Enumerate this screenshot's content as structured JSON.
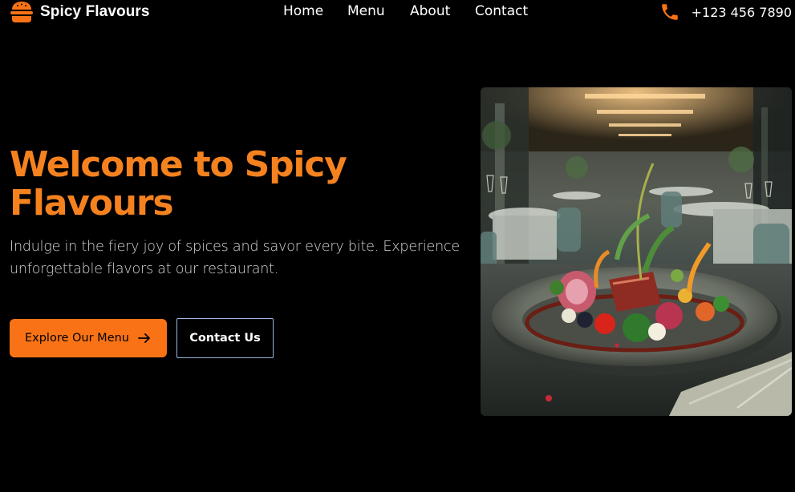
{
  "header": {
    "brand": {
      "name": "Spicy Flavours",
      "icon": "burger-icon",
      "icon_color": "#f97316"
    },
    "nav": [
      {
        "label": "Home"
      },
      {
        "label": "Menu"
      },
      {
        "label": "About"
      },
      {
        "label": "Contact"
      }
    ],
    "phone": {
      "number": "+123 456 7890",
      "icon": "phone-icon",
      "icon_color": "#f97316"
    }
  },
  "hero": {
    "title": "Welcome to Spicy Flavours",
    "subtitle": "Indulge in the fiery joy of spices and savor every bite. Experience unforgettable flavors at our restaurant.",
    "primary_button": {
      "label": "Explore Our Menu",
      "icon": "arrow-right-icon"
    },
    "secondary_button": {
      "label": "Contact Us"
    },
    "image": {
      "subject": "gourmet-dish-restaurant-photo"
    }
  },
  "colors": {
    "accent": "#f97316",
    "title": "#f5821f",
    "background": "#000000",
    "outline_button_border": "#9cb5df"
  }
}
